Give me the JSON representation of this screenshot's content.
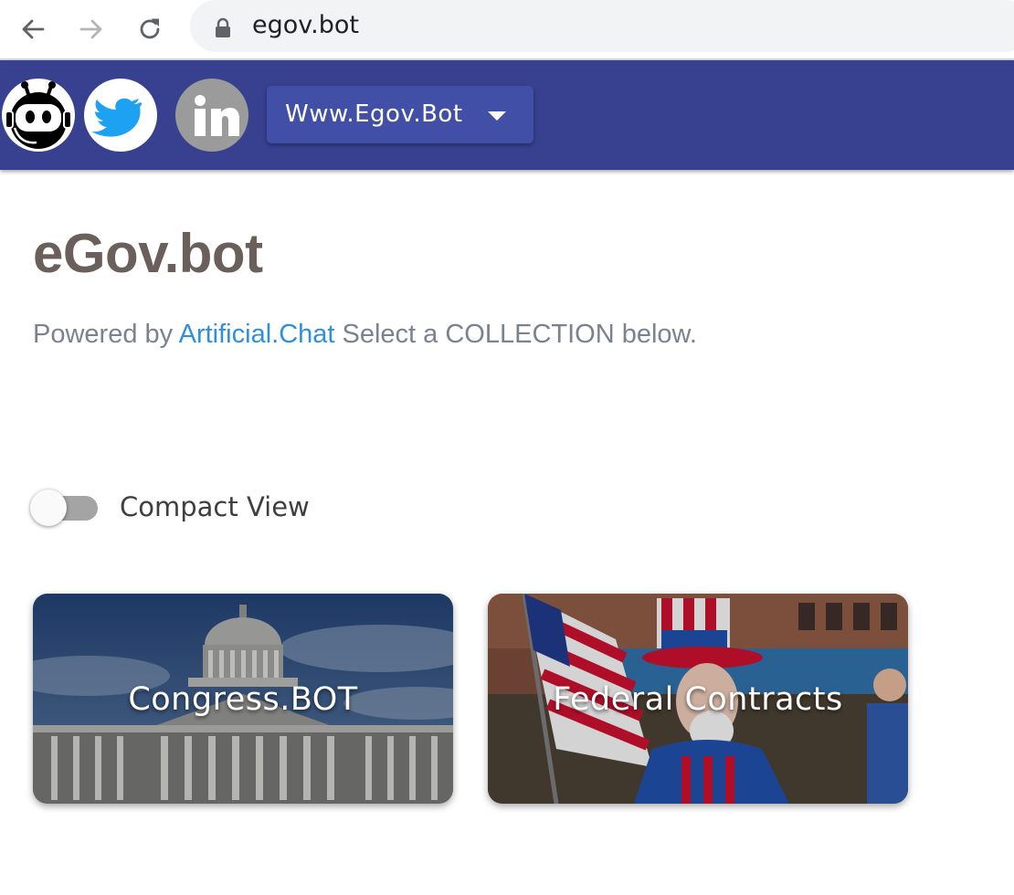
{
  "browser": {
    "url": "egov.bot",
    "icons": {
      "back": "arrow-left-icon",
      "forward": "arrow-right-icon",
      "reload": "reload-icon",
      "lock": "lock-icon"
    }
  },
  "appbar": {
    "background_color": "#37418f",
    "avatars": [
      {
        "name": "bot-avatar",
        "icon": "robot-icon"
      },
      {
        "name": "twitter-avatar",
        "icon": "twitter-bird-icon"
      },
      {
        "name": "linkedin-avatar",
        "icon": "linkedin-icon"
      }
    ],
    "site_menu": {
      "label": "Www.Egov.Bot",
      "icon": "caret-down-icon"
    }
  },
  "header": {
    "title": "eGov.bot",
    "powered_prefix": "Powered by",
    "powered_link": "Artificial.Chat",
    "instruction": "Select a COLLECTION below.",
    "link_color": "#2f8fdf"
  },
  "compact_view": {
    "label": "Compact View",
    "enabled": false
  },
  "collections": [
    {
      "title": "Congress.BOT",
      "image": "capitol-building"
    },
    {
      "title": "Federal Contracts",
      "image": "uncle-sam-flag"
    }
  ]
}
